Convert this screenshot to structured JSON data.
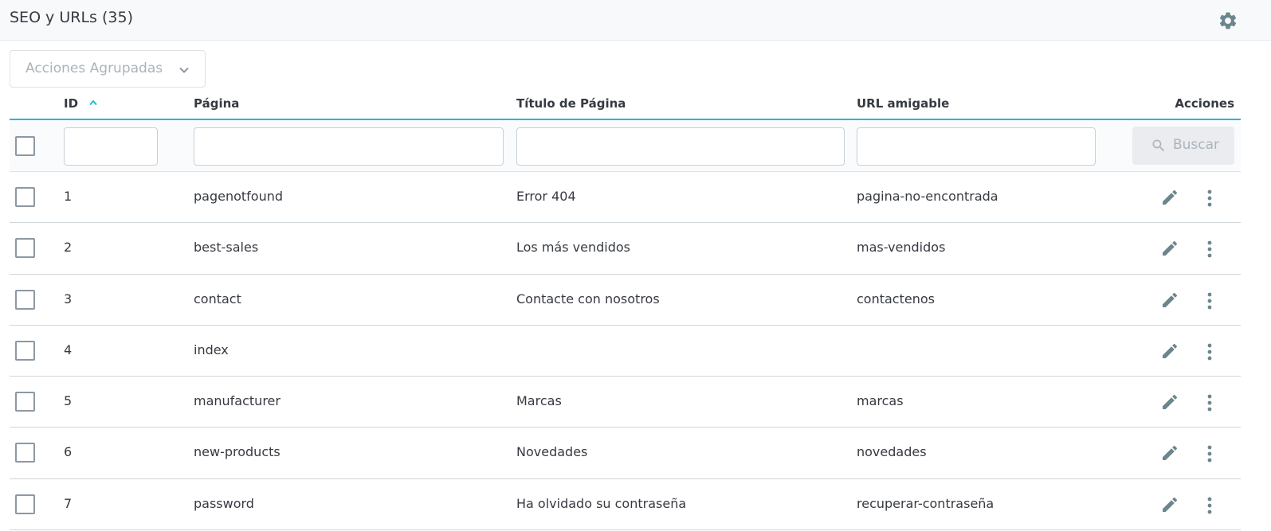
{
  "header": {
    "title": "SEO y URLs (35)",
    "settings_icon": "gear-icon"
  },
  "bulk_actions": {
    "label": "Acciones Agrupadas",
    "icon": "chevron-down-icon"
  },
  "table": {
    "columns": {
      "id": "ID",
      "page": "Página",
      "title": "Título de Página",
      "url": "URL amigable",
      "actions": "Acciones"
    },
    "sort": {
      "column": "ID",
      "direction": "asc"
    },
    "filters": {
      "id": "",
      "page": "",
      "title": "",
      "url": ""
    },
    "search_button": "Buscar",
    "rows": [
      {
        "id": "1",
        "page": "pagenotfound",
        "title": "Error 404",
        "url": "pagina-no-encontrada"
      },
      {
        "id": "2",
        "page": "best-sales",
        "title": "Los más vendidos",
        "url": "mas-vendidos"
      },
      {
        "id": "3",
        "page": "contact",
        "title": "Contacte con nosotros",
        "url": "contactenos"
      },
      {
        "id": "4",
        "page": "index",
        "title": "",
        "url": ""
      },
      {
        "id": "5",
        "page": "manufacturer",
        "title": "Marcas",
        "url": "marcas"
      },
      {
        "id": "6",
        "page": "new-products",
        "title": "Novedades",
        "url": "novedades"
      },
      {
        "id": "7",
        "page": "password",
        "title": "Ha olvidado su contraseña",
        "url": "recuperar-contraseña"
      }
    ]
  },
  "colors": {
    "accent": "#25b9d7",
    "icon_gray": "#6c868e",
    "text": "#363a41",
    "muted": "#aab4bc"
  }
}
